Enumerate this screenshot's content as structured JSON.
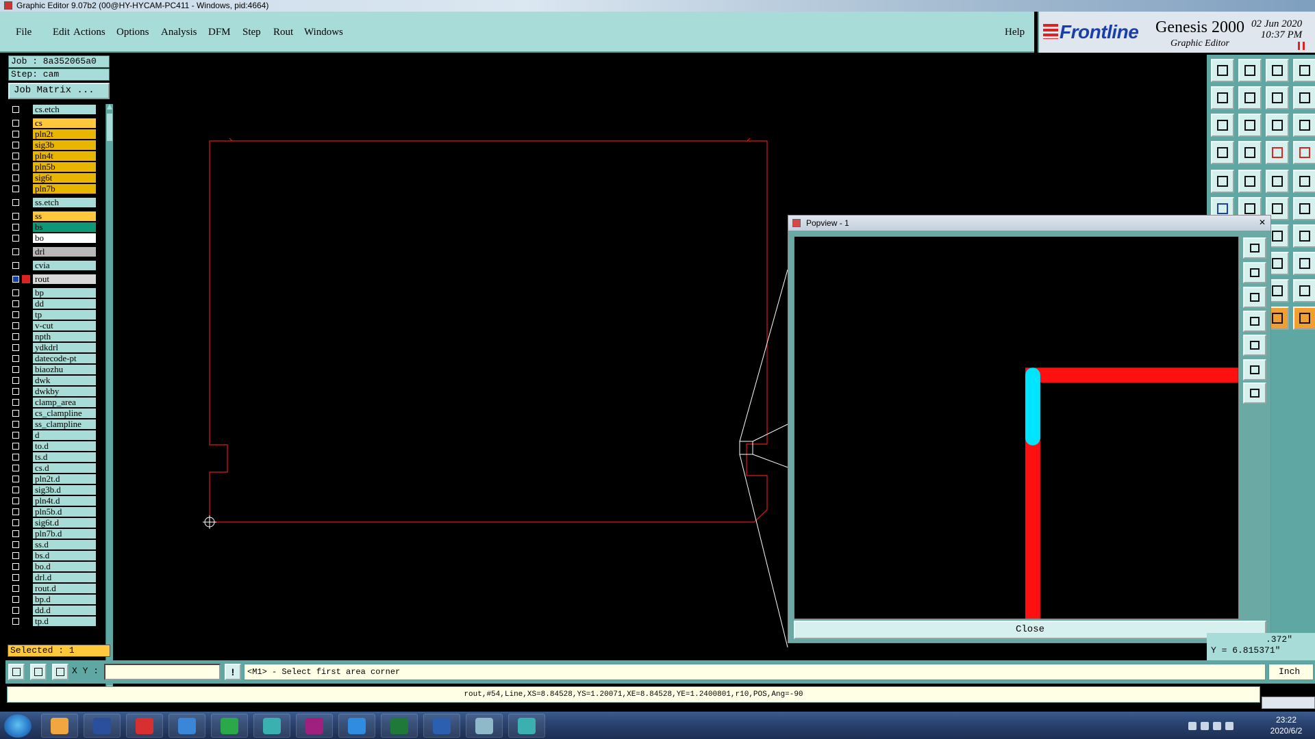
{
  "window": {
    "title": "Graphic Editor 9.07b2 (00@HY-HYCAM-PC411 - Windows, pid:4664)"
  },
  "menu": {
    "items": [
      "File",
      "Edit",
      "Actions",
      "Options",
      "Analysis",
      "DFM",
      "Step",
      "Rout",
      "Windows"
    ],
    "help": "Help"
  },
  "brand": {
    "logo": "Frontline",
    "product": "Genesis 2000",
    "subtitle": "Graphic Editor",
    "date": "02 Jun 2020",
    "time": "10:37 PM"
  },
  "job": {
    "job_label": "Job : 8a352065a0",
    "step_label": "Step: cam",
    "matrix_button": "Job Matrix ..."
  },
  "layers": [
    {
      "name": "cs.etch",
      "color": "teal"
    },
    {
      "name": "cs",
      "color": "amber"
    },
    {
      "name": "pln2t",
      "color": "yellow"
    },
    {
      "name": "sig3b",
      "color": "yellow"
    },
    {
      "name": "pln4t",
      "color": "yellow"
    },
    {
      "name": "pln5b",
      "color": "yellow"
    },
    {
      "name": "sig6t",
      "color": "yellow"
    },
    {
      "name": "pln7b",
      "color": "yellow"
    },
    {
      "name": "ss.etch",
      "color": "teal"
    },
    {
      "name": "ss",
      "color": "amber"
    },
    {
      "name": "bs",
      "color": "green"
    },
    {
      "name": "bo",
      "color": "white"
    },
    {
      "name": "drl",
      "color": "gray"
    },
    {
      "name": "cvia",
      "color": "teal"
    },
    {
      "name": "rout",
      "color": "rout"
    },
    {
      "name": "bp",
      "color": "teal"
    },
    {
      "name": "dd",
      "color": "teal"
    },
    {
      "name": "tp",
      "color": "teal"
    },
    {
      "name": "v-cut",
      "color": "teal"
    },
    {
      "name": "npth",
      "color": "teal"
    },
    {
      "name": "ydkdrl",
      "color": "teal"
    },
    {
      "name": "datecode-pt",
      "color": "teal"
    },
    {
      "name": "biaozhu",
      "color": "teal"
    },
    {
      "name": "dwk",
      "color": "teal"
    },
    {
      "name": "dwkby",
      "color": "teal"
    },
    {
      "name": "clamp_area",
      "color": "teal"
    },
    {
      "name": "cs_clampline",
      "color": "teal"
    },
    {
      "name": "ss_clampline",
      "color": "teal"
    },
    {
      "name": "d",
      "color": "teal"
    },
    {
      "name": "to.d",
      "color": "teal"
    },
    {
      "name": "ts.d",
      "color": "teal"
    },
    {
      "name": "cs.d",
      "color": "teal"
    },
    {
      "name": "pln2t.d",
      "color": "teal"
    },
    {
      "name": "sig3b.d",
      "color": "teal"
    },
    {
      "name": "pln4t.d",
      "color": "teal"
    },
    {
      "name": "pln5b.d",
      "color": "teal"
    },
    {
      "name": "sig6t.d",
      "color": "teal"
    },
    {
      "name": "pln7b.d",
      "color": "teal"
    },
    {
      "name": "ss.d",
      "color": "teal"
    },
    {
      "name": "bs.d",
      "color": "teal"
    },
    {
      "name": "bo.d",
      "color": "teal"
    },
    {
      "name": "drl.d",
      "color": "teal"
    },
    {
      "name": "rout.d",
      "color": "teal"
    },
    {
      "name": "bp.d",
      "color": "teal"
    },
    {
      "name": "dd.d",
      "color": "teal"
    },
    {
      "name": "tp.d",
      "color": "teal"
    }
  ],
  "selection": {
    "text": "Selected : 1"
  },
  "popview": {
    "title": "Popview - 1",
    "close_button": "Close"
  },
  "coords": {
    "x_partial": ".372\"",
    "y": "Y = 6.815371\""
  },
  "command": {
    "xy_label": "X Y :",
    "xy_value": "",
    "bang": "!",
    "prompt": "<M1> - Select first area corner",
    "unit": "Inch"
  },
  "status": {
    "text": "rout,#54,Line,XS=8.84528,YS=1.20071,XE=8.84528,YE=1.2400801,r10,POS,Ang=-90"
  },
  "taskbar": {
    "time": "23:22",
    "date": "2020/6/2"
  },
  "colors": {
    "panel": "#a8dcd8",
    "panel_dark": "#5ea7a2",
    "rout_red": "#ff1010",
    "highlight_cyan": "#00e5ff"
  }
}
